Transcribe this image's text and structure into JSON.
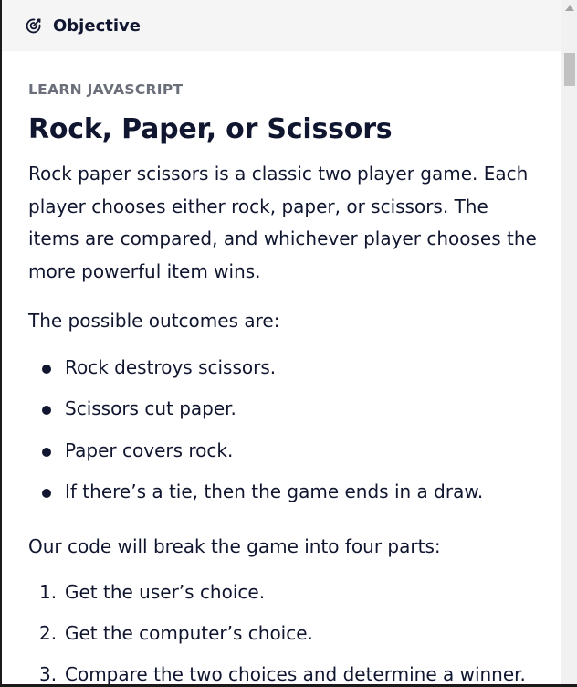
{
  "header": {
    "title": "Objective",
    "icon": "target-icon"
  },
  "lesson": {
    "eyebrow": "LEARN JAVASCRIPT",
    "title": "Rock, Paper, or Scissors",
    "intro": "Rock paper scissors is a classic two player game. Each player chooses either rock, paper, or scissors. The items are compared, and whichever player chooses the more powerful item wins.",
    "outcomes_heading": "The possible outcomes are:",
    "outcomes": [
      "Rock destroys scissors.",
      "Scissors cut paper.",
      "Paper covers rock.",
      "If there’s a tie, then the game ends in a draw."
    ],
    "parts_heading": "Our code will break the game into four parts:",
    "parts": [
      {
        "number": "1.",
        "text": "Get the user’s choice."
      },
      {
        "number": "2.",
        "text": "Get the computer’s choice."
      },
      {
        "number": "3.",
        "text": "Compare the two choices and determine a winner."
      }
    ]
  },
  "colors": {
    "text": "#10162f",
    "eyebrow": "#6b6f7a",
    "header_bg": "#f5f5f6"
  }
}
